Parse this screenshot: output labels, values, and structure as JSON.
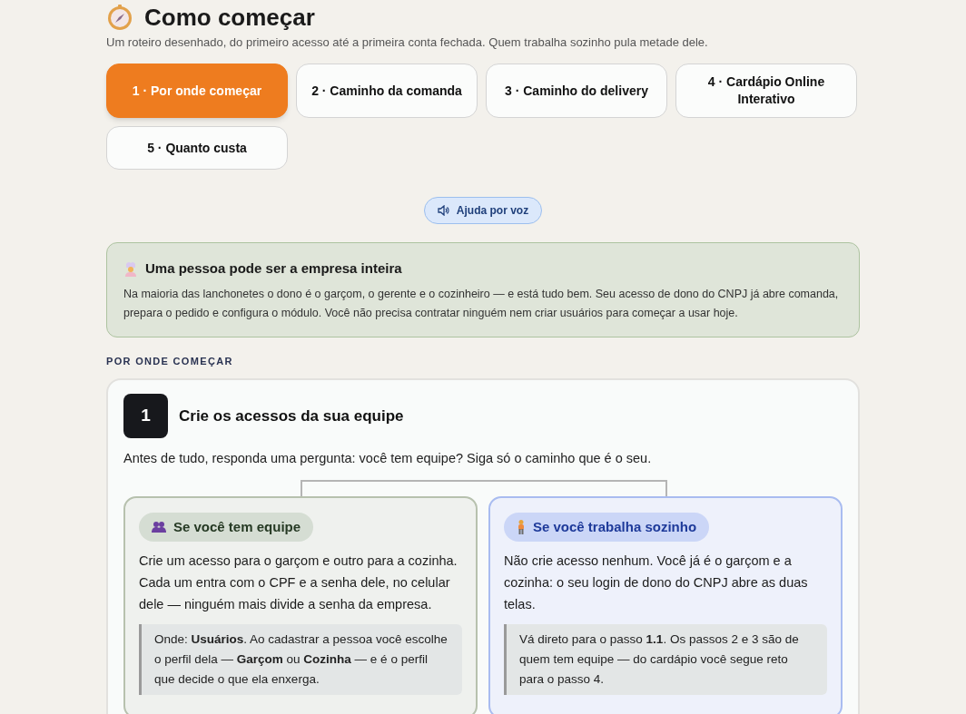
{
  "page": {
    "title": "Como começar",
    "subtitle": "Um roteiro desenhado, do primeiro acesso até a primeira conta fechada. Quem trabalha sozinho pula metade dele."
  },
  "tabs": [
    {
      "label": "1 · Por onde começar",
      "selected": true
    },
    {
      "label": "2 · Caminho da comanda",
      "selected": false
    },
    {
      "label": "3 · Caminho do delivery",
      "selected": false
    },
    {
      "label": "4 · Cardápio Online Interativo",
      "selected": false
    },
    {
      "label": "5 · Quanto custa",
      "selected": false
    }
  ],
  "voice_help": {
    "label": "Ajuda por voz"
  },
  "callout": {
    "title": "Uma pessoa pode ser a empresa inteira",
    "text": "Na maioria das lanchonetes o dono é o garçom, o gerente e o cozinheiro — e está tudo bem. Seu acesso de dono do CNPJ já abre comanda, prepara o pedido e configura o módulo. Você não precisa contratar ninguém nem criar usuários para começar a usar hoje."
  },
  "section_label": "POR ONDE COMEÇAR",
  "step": {
    "number": "1",
    "title": "Crie os acessos da sua equipe",
    "intro": "Antes de tudo, responda uma pergunta: você tem equipe? Siga só o caminho que é o seu.",
    "paths": [
      {
        "kind": "team",
        "label": "Se você tem equipe",
        "text": "Crie um acesso para o garçom e outro para a cozinha. Cada um entra com o CPF e a senha dele, no celular dele — ninguém mais divide a senha da empresa.",
        "note": "Onde: **Usuários**. Ao cadastrar a pessoa você escolhe o perfil dela — **Garçom** ou **Cozinha** — e é o perfil que decide o que ela enxerga."
      },
      {
        "kind": "solo",
        "label": "Se você trabalha sozinho",
        "text": "Não crie acesso nenhum. Você já é o garçom e a cozinha: o seu login de dono do CNPJ abre as duas telas.",
        "note": "Vá direto para o passo **1.1**. Os passos 2 e 3 são de quem tem equipe — do cardápio você segue reto para o passo 4."
      }
    ]
  }
}
